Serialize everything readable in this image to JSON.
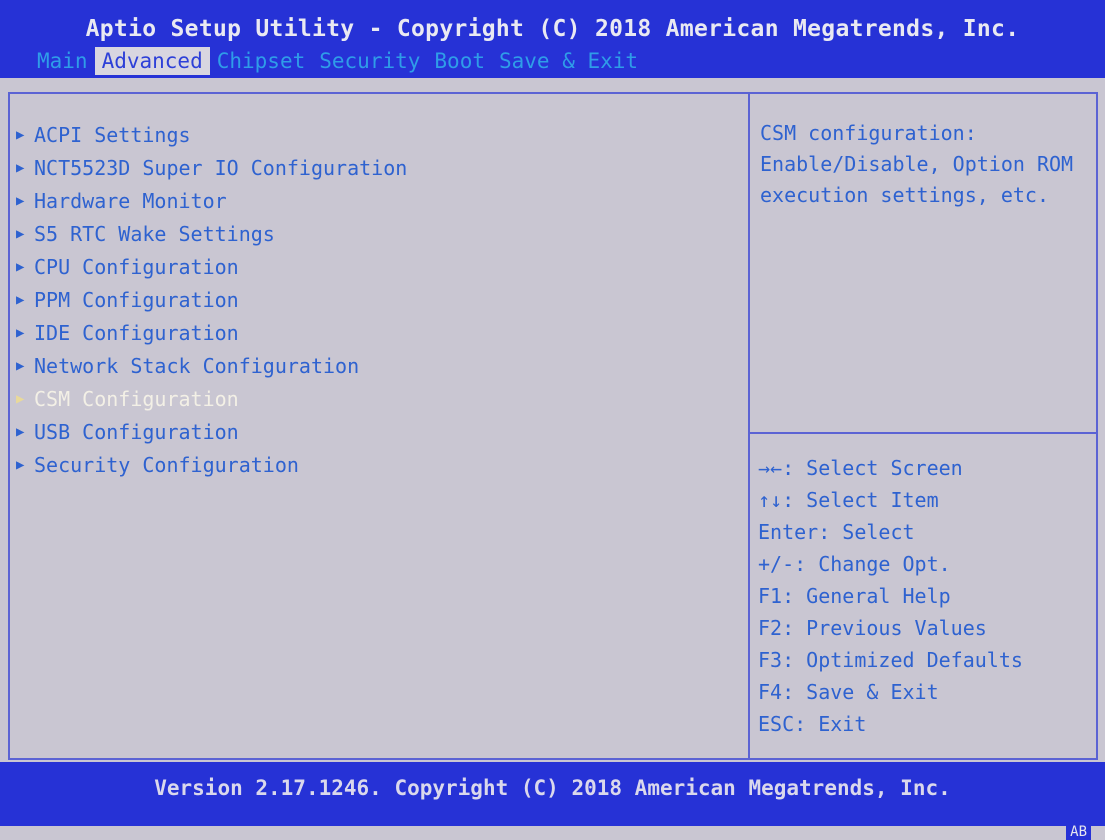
{
  "header": {
    "title": "Aptio Setup Utility - Copyright (C) 2018 American Megatrends, Inc.",
    "tabs": [
      {
        "label": "Main",
        "active": false
      },
      {
        "label": "Advanced",
        "active": true
      },
      {
        "label": "Chipset",
        "active": false
      },
      {
        "label": "Security",
        "active": false
      },
      {
        "label": "Boot",
        "active": false
      },
      {
        "label": "Save & Exit",
        "active": false
      }
    ]
  },
  "menu": {
    "selected_index": 8,
    "items": [
      {
        "label": "ACPI Settings"
      },
      {
        "label": "NCT5523D Super IO Configuration"
      },
      {
        "label": "Hardware Monitor"
      },
      {
        "label": "S5 RTC Wake Settings"
      },
      {
        "label": "CPU Configuration"
      },
      {
        "label": "PPM Configuration"
      },
      {
        "label": "IDE Configuration"
      },
      {
        "label": "Network Stack Configuration"
      },
      {
        "label": "CSM Configuration"
      },
      {
        "label": "USB Configuration"
      },
      {
        "label": "Security Configuration"
      }
    ]
  },
  "help": {
    "description": "CSM configuration: Enable/Disable, Option ROM execution settings, etc."
  },
  "keys": [
    "→←: Select Screen",
    "↑↓: Select Item",
    "Enter: Select",
    "+/-: Change Opt.",
    "F1: General Help",
    "F2: Previous Values",
    "F3: Optimized Defaults",
    "F4: Save & Exit",
    "ESC: Exit"
  ],
  "footer": {
    "version": "Version 2.17.1246. Copyright (C) 2018 American Megatrends, Inc.",
    "badge": "AB"
  },
  "colors": {
    "bar_blue": "#2632d6",
    "panel_bg": "#c9c6d2",
    "text_blue": "#2e62d0",
    "tab_inactive": "#2f9de8",
    "selected_text": "#f3f0e6"
  }
}
